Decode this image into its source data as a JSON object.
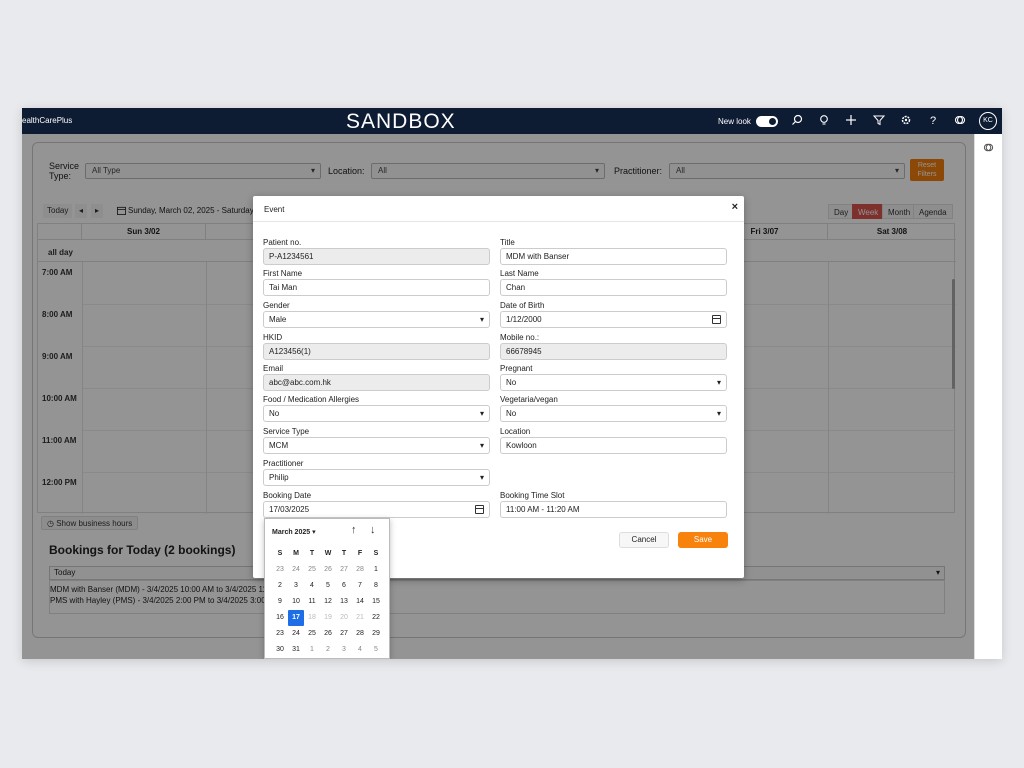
{
  "topbar": {
    "brand": "ealthCarePlus",
    "title": "SANDBOX",
    "new_look_label": "New look",
    "avatar": "KC",
    "icons": [
      "search-icon",
      "lightbulb-icon",
      "plus-icon",
      "filter-icon",
      "gear-icon",
      "help-icon",
      "copilot-icon"
    ]
  },
  "filters": {
    "service_type_label": "Service Type:",
    "service_type_value": "All Type",
    "location_label": "Location:",
    "location_value": "All",
    "practitioner_label": "Practitioner:",
    "practitioner_value": "All",
    "reset_label": "Reset Filters"
  },
  "calendar": {
    "today_label": "Today",
    "date_range": "Sunday, March 02, 2025 - Saturday",
    "views": [
      "Day",
      "Week",
      "Month",
      "Agenda"
    ],
    "active_view": "Week",
    "columns": [
      "Sun 3/02",
      "",
      "",
      "",
      "",
      "Fri 3/07",
      "Sat 3/08"
    ],
    "allday_label": "all day",
    "times": [
      "7:00 AM",
      "8:00 AM",
      "9:00 AM",
      "10:00 AM",
      "11:00 AM",
      "12:00 PM"
    ],
    "show_business_hours": "Show business hours"
  },
  "bookings": {
    "heading": "Bookings for Today (2 bookings)",
    "filter_value": "Today",
    "items": [
      "MDM with Banser (MDM) - 3/4/2025 10:00 AM to 3/4/2025 11:",
      "PMS with Hayley (PMS) - 3/4/2025 2:00 PM to 3/4/2025 3:00"
    ]
  },
  "modal": {
    "title": "Event",
    "close": "×",
    "fields": {
      "patient_no": {
        "label": "Patient no.",
        "value": "P-A1234561"
      },
      "title": {
        "label": "Title",
        "value": "MDM with Banser"
      },
      "first_name": {
        "label": "First Name",
        "value": "Tai Man"
      },
      "last_name": {
        "label": "Last Name",
        "value": "Chan"
      },
      "gender": {
        "label": "Gender",
        "value": "Male"
      },
      "dob": {
        "label": "Date of Birth",
        "value": "1/12/2000"
      },
      "hkid": {
        "label": "HKID",
        "value": "A123456(1)"
      },
      "mobile": {
        "label": "Mobile no.:",
        "value": "66678945"
      },
      "email": {
        "label": "Email",
        "value": "abc@abc.com.hk"
      },
      "pregnant": {
        "label": "Pregnant",
        "value": "No"
      },
      "allergies": {
        "label": "Food / Medication Allergies",
        "value": "No"
      },
      "vegetarian": {
        "label": "Vegetaria/vegan",
        "value": "No"
      },
      "service_type": {
        "label": "Service Type",
        "value": "MCM"
      },
      "location": {
        "label": "Location",
        "value": "Kowloon"
      },
      "practitioner": {
        "label": "Practitioner",
        "value": "Philip"
      },
      "booking_date": {
        "label": "Booking Date",
        "value": "17/03/2025"
      },
      "booking_time": {
        "label": "Booking Time Slot",
        "value": "11:00 AM - 11:20 AM"
      }
    },
    "cancel_label": "Cancel",
    "save_label": "Save"
  },
  "datepicker": {
    "month_label": "March 2025 ▾",
    "weekdays": [
      "S",
      "M",
      "T",
      "W",
      "T",
      "F",
      "S"
    ],
    "weeks": [
      [
        "23",
        "24",
        "25",
        "26",
        "27",
        "28",
        "1"
      ],
      [
        "2",
        "3",
        "4",
        "5",
        "6",
        "7",
        "8"
      ],
      [
        "9",
        "10",
        "11",
        "12",
        "13",
        "14",
        "15"
      ],
      [
        "16",
        "17",
        "18",
        "19",
        "20",
        "21",
        "22"
      ],
      [
        "23",
        "24",
        "25",
        "26",
        "27",
        "28",
        "29"
      ],
      [
        "30",
        "31",
        "1",
        "2",
        "3",
        "4",
        "5"
      ]
    ],
    "selected": "17"
  },
  "colors": {
    "topbar": "#0d1b33",
    "accent": "#f7820c",
    "week_active": "#d9534f",
    "selected_day": "#1e6ee8"
  }
}
